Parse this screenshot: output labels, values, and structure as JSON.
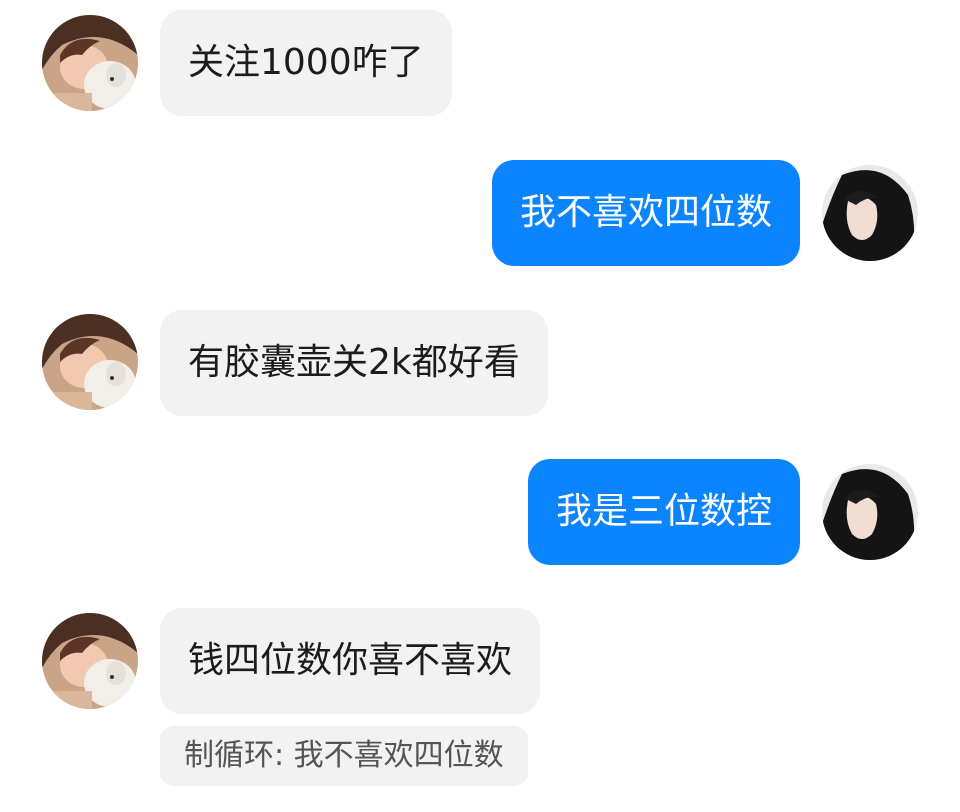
{
  "messages": [
    {
      "side": "left",
      "text": "关注1000咋了"
    },
    {
      "side": "right",
      "text": "我不喜欢四位数"
    },
    {
      "side": "left",
      "text": "有胶囊壶关2k都好看"
    },
    {
      "side": "right",
      "text": "我是三位数控"
    },
    {
      "side": "left",
      "text": "钱四位数你喜不喜欢"
    }
  ],
  "quote": {
    "text": "制循环: 我不喜欢四位数"
  },
  "colors": {
    "bubble_left_bg": "#f2f2f2",
    "bubble_right_bg": "#0b84ff",
    "text_dark": "#1c1c1c",
    "text_light": "#ffffff"
  },
  "avatars": {
    "left": "avatar-girl-with-dog",
    "right": "avatar-dark-hair-profile"
  }
}
